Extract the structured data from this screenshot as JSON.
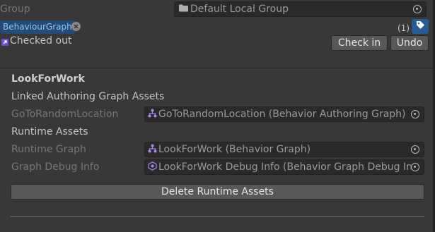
{
  "header": {
    "group_label": "Group",
    "group_value": "Default Local Group",
    "label_tag": "BehaviourGraph",
    "label_count": "(1)",
    "checked_out_text": "Checked out",
    "check_in_label": "Check in",
    "undo_label": "Undo"
  },
  "inspector": {
    "title": "LookForWork",
    "linked_section": "Linked Authoring Graph Assets",
    "linked_field_label": "GoToRandomLocation",
    "linked_field_value": "GoToRandomLocation (Behavior Authoring Graph)",
    "runtime_section": "Runtime Assets",
    "runtime_graph_label": "Runtime Graph",
    "runtime_graph_value": "LookForWork (Behavior Graph)",
    "debug_label": "Graph Debug Info",
    "debug_value": "LookForWork Debug Info (Behavior Graph Debug Info)",
    "delete_button": "Delete Runtime Assets"
  },
  "colors": {
    "background": "#383838",
    "tag_background": "#254a75",
    "tag_text": "#8cc4f5",
    "graph_icon": "#a58bea"
  }
}
